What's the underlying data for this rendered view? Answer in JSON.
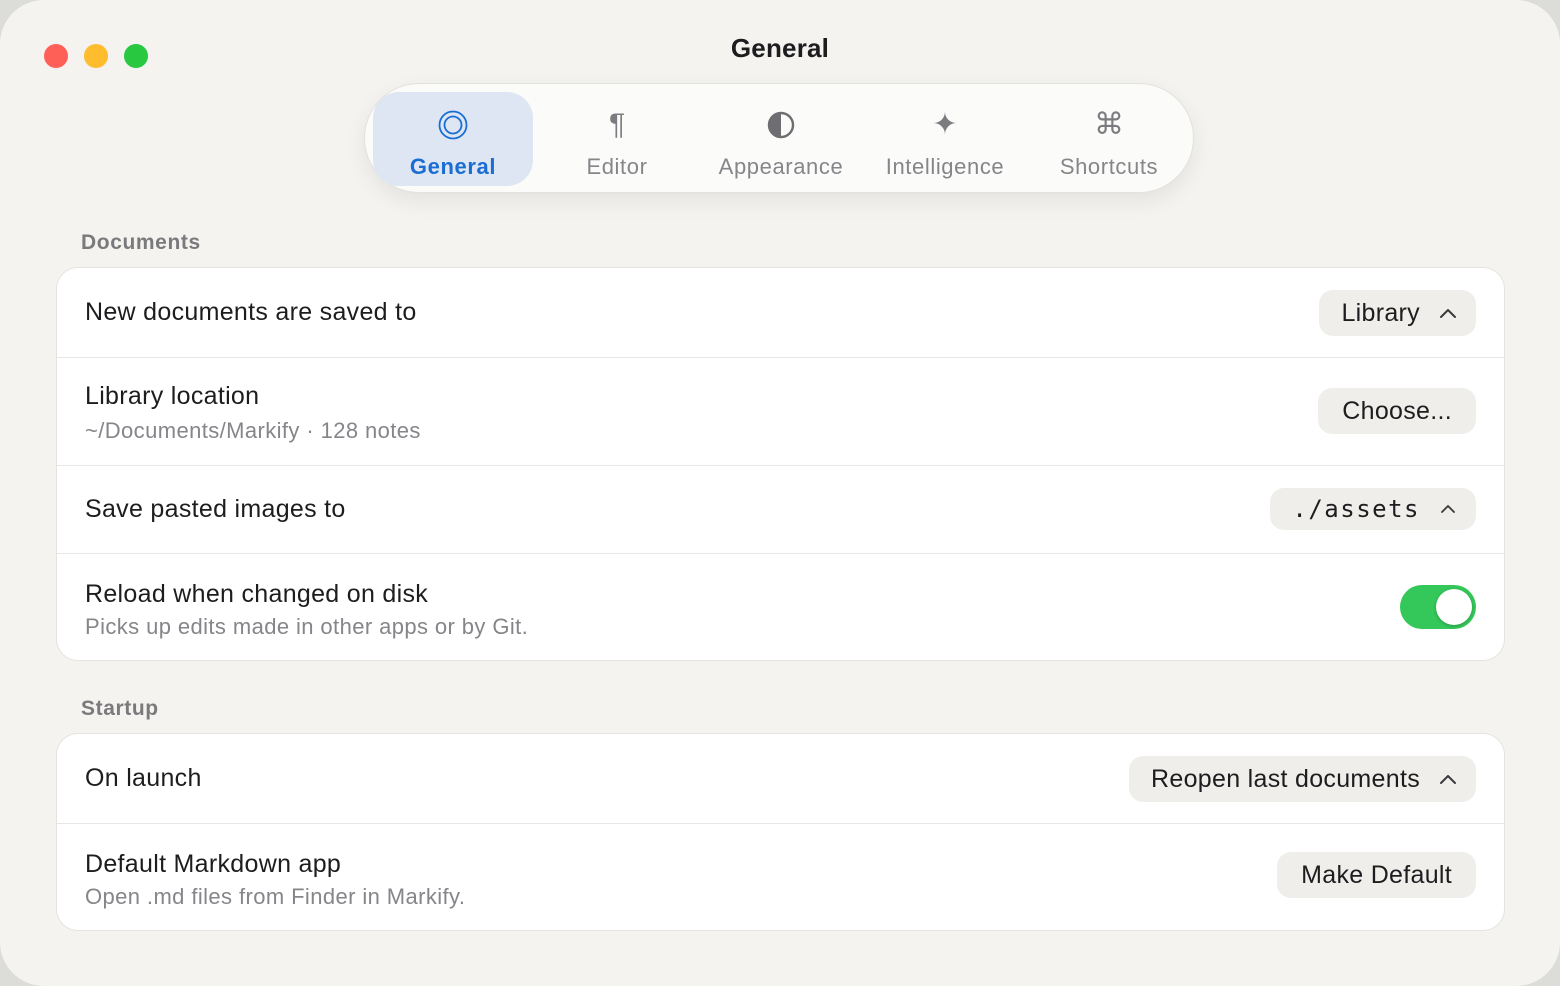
{
  "window": {
    "title": "General"
  },
  "toolbar": {
    "tabs": [
      {
        "label": "General",
        "icon": "target-icon",
        "selected": true
      },
      {
        "label": "Editor",
        "icon": "pilcrow-icon",
        "glyph": "¶"
      },
      {
        "label": "Appearance",
        "icon": "half-circle-icon"
      },
      {
        "label": "Intelligence",
        "icon": "sparkle-icon",
        "glyph": "✦"
      },
      {
        "label": "Shortcuts",
        "icon": "command-icon",
        "glyph": "⌘"
      }
    ]
  },
  "documents": {
    "title": "Documents",
    "save_to": {
      "label": "New documents are saved to",
      "value": "Library"
    },
    "library_location": {
      "label": "Library location",
      "sub": "~/Documents/Markify · 128 notes",
      "button": "Choose..."
    },
    "pasted_images": {
      "label": "Save pasted images to",
      "value": "./assets"
    },
    "reload": {
      "label": "Reload when changed on disk",
      "sub": "Picks up edits made in other apps or by Git.",
      "enabled": true
    }
  },
  "startup": {
    "title": "Startup",
    "on_launch": {
      "label": "On launch",
      "value": "Reopen last documents"
    },
    "default_app": {
      "label": "Default Markdown app",
      "sub": "Open .md files from Finder in Markify.",
      "button": "Make Default"
    }
  },
  "colors": {
    "accent": "#1a6ed3",
    "selected_tab_bg": "#dde6f2",
    "toggle_on": "#34c759",
    "close": "#fe5f57",
    "minimize": "#febc2e",
    "zoom": "#28c840"
  }
}
